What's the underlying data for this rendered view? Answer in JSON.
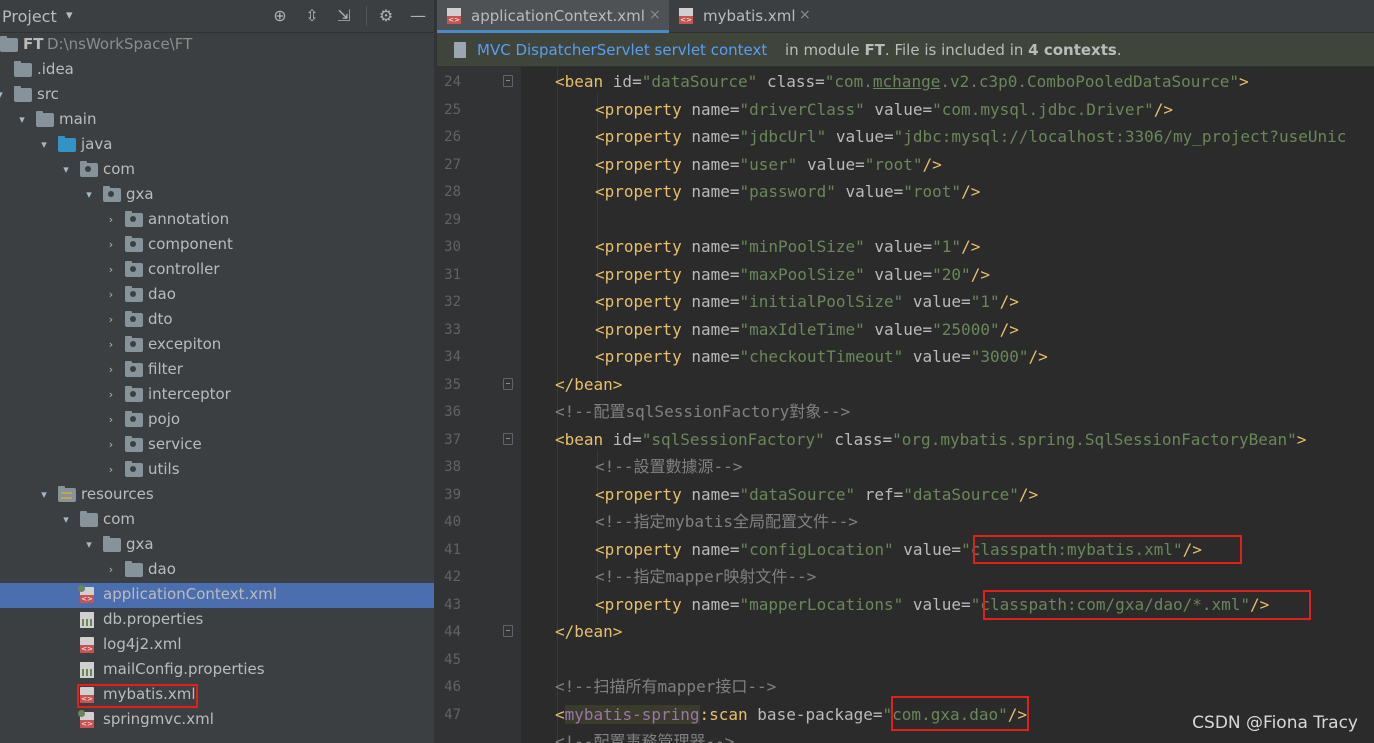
{
  "panel": {
    "title": "Project",
    "dropdown": "▾",
    "icons": [
      "target-icon",
      "expand-all-icon",
      "collapse-all-icon",
      "gear-icon",
      "hide-icon"
    ]
  },
  "tree": {
    "root_name": "FT",
    "root_path": "D:\\nsWorkSpace\\FT",
    "rows": [
      {
        "label": "FT",
        "depth": 0,
        "arrow": "",
        "icon": "folder-gray"
      },
      {
        "label": ".idea",
        "depth": 1,
        "arrow": "",
        "icon": "folder-gray"
      },
      {
        "label": "src",
        "depth": 1,
        "arrow": "▾",
        "icon": "folder-gray"
      },
      {
        "label": "main",
        "depth": 2,
        "arrow": "▾",
        "icon": "folder-gray"
      },
      {
        "label": "java",
        "depth": 3,
        "arrow": "▾",
        "icon": "folder-blue"
      },
      {
        "label": "com",
        "depth": 4,
        "arrow": "▾",
        "icon": "package"
      },
      {
        "label": "gxa",
        "depth": 5,
        "arrow": "▾",
        "icon": "package"
      },
      {
        "label": "annotation",
        "depth": 6,
        "arrow": "›",
        "icon": "package"
      },
      {
        "label": "component",
        "depth": 6,
        "arrow": "›",
        "icon": "package"
      },
      {
        "label": "controller",
        "depth": 6,
        "arrow": "›",
        "icon": "package"
      },
      {
        "label": "dao",
        "depth": 6,
        "arrow": "›",
        "icon": "package"
      },
      {
        "label": "dto",
        "depth": 6,
        "arrow": "›",
        "icon": "package"
      },
      {
        "label": "excepiton",
        "depth": 6,
        "arrow": "›",
        "icon": "package"
      },
      {
        "label": "filter",
        "depth": 6,
        "arrow": "›",
        "icon": "package"
      },
      {
        "label": "interceptor",
        "depth": 6,
        "arrow": "›",
        "icon": "package"
      },
      {
        "label": "pojo",
        "depth": 6,
        "arrow": "›",
        "icon": "package"
      },
      {
        "label": "service",
        "depth": 6,
        "arrow": "›",
        "icon": "package"
      },
      {
        "label": "utils",
        "depth": 6,
        "arrow": "›",
        "icon": "package"
      },
      {
        "label": "resources",
        "depth": 3,
        "arrow": "▾",
        "icon": "resources"
      },
      {
        "label": "com",
        "depth": 4,
        "arrow": "▾",
        "icon": "folder-gray"
      },
      {
        "label": "gxa",
        "depth": 5,
        "arrow": "▾",
        "icon": "folder-gray"
      },
      {
        "label": "dao",
        "depth": 6,
        "arrow": "›",
        "icon": "folder-gray"
      },
      {
        "label": "applicationContext.xml",
        "depth": 4,
        "arrow": "",
        "icon": "xml-spring",
        "selected": true
      },
      {
        "label": "db.properties",
        "depth": 4,
        "arrow": "",
        "icon": "properties"
      },
      {
        "label": "log4j2.xml",
        "depth": 4,
        "arrow": "",
        "icon": "xml"
      },
      {
        "label": "mailConfig.properties",
        "depth": 4,
        "arrow": "",
        "icon": "properties"
      },
      {
        "label": "mybatis.xml",
        "depth": 4,
        "arrow": "",
        "icon": "xml",
        "highlighted": true
      },
      {
        "label": "springmvc.xml",
        "depth": 4,
        "arrow": "",
        "icon": "xml-spring"
      }
    ]
  },
  "tabs": [
    {
      "label": "applicationContext.xml",
      "active": true,
      "close": "×"
    },
    {
      "label": "mybatis.xml",
      "active": false,
      "close": "×"
    }
  ],
  "context_bar": {
    "link": "MVC DispatcherServlet servlet context",
    "text_prefix": "in module ",
    "module": "FT",
    "text_mid": ". File is included in ",
    "count": "4 contexts",
    "text_suffix": "."
  },
  "editor": {
    "line_numbers": [
      "24",
      "25",
      "26",
      "27",
      "28",
      "29",
      "30",
      "31",
      "32",
      "33",
      "34",
      "35",
      "36",
      "37",
      "38",
      "39",
      "40",
      "41",
      "42",
      "43",
      "44",
      "45",
      "46",
      "47"
    ]
  },
  "watermark": "CSDN @Fiona Tracy"
}
